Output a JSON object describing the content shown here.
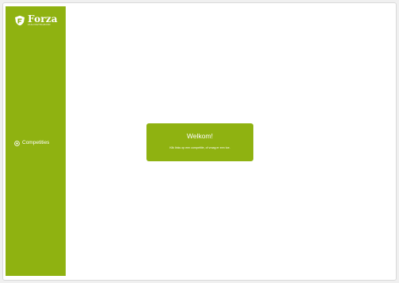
{
  "brand": {
    "name": "Forza",
    "tagline": "ZAALVOETBALBOND",
    "color": "#8fb211",
    "logo_icon": "forza-shield-icon"
  },
  "sidebar": {
    "items": [
      {
        "label": "Competities",
        "icon": "football-icon"
      }
    ]
  },
  "welcome": {
    "title": "Welkom!",
    "text": "Klik links op een competitie, of vraag er een toe."
  }
}
